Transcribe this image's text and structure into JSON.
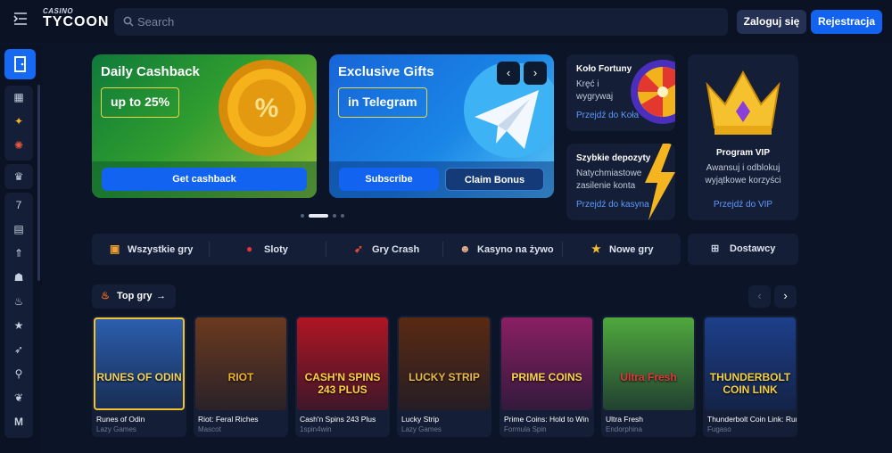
{
  "header": {
    "logo_small": "CASINO",
    "logo_big": "TYCOON",
    "search_placeholder": "Search",
    "login_label": "Zaloguj się",
    "register_label": "Rejestracja"
  },
  "banners": [
    {
      "title": "Daily Cashback",
      "badge": "up to 25%",
      "button": "Get cashback"
    },
    {
      "title": "Exclusive Gifts",
      "badge": "in Telegram",
      "button_primary": "Subscribe",
      "button_secondary": "Claim Bonus"
    }
  ],
  "wheel_card": {
    "title": "Koło Fortuny",
    "text_lines": [
      "Kręć i",
      "wygrywaj"
    ],
    "link": "Przejdź do Koła"
  },
  "deposit_card": {
    "title": "Szybkie depozyty",
    "text_lines": [
      "Natychmiastowe",
      "zasilenie konta"
    ],
    "link": "Przejdź do kasyna"
  },
  "vip_card": {
    "title": "Program VIP",
    "text_lines": [
      "Awansuj i odblokuj",
      "wyjątkowe korzyści"
    ],
    "link": "Przejdź do VIP"
  },
  "categories": [
    {
      "label": "Wszystkie gry",
      "icon": "slot-machine-icon"
    },
    {
      "label": "Sloty",
      "icon": "cherry-icon"
    },
    {
      "label": "Gry Crash",
      "icon": "rocket-icon"
    },
    {
      "label": "Kasyno na żywo",
      "icon": "dealer-icon"
    },
    {
      "label": "Nowe gry",
      "icon": "star-icon"
    }
  ],
  "providers_label": "Dostawcy",
  "top_games_label": "Top gry",
  "games": [
    {
      "name": "Runes of Odin",
      "provider": "Lazy Games",
      "thumb_text": "RUNES OF ODIN",
      "bg": "#2b5fb0",
      "accent": "#f4d35e"
    },
    {
      "name": "Riot: Feral Riches",
      "provider": "Mascot",
      "thumb_text": "RIOT",
      "bg": "#6b3a1f",
      "accent": "#f0b429"
    },
    {
      "name": "Cash'n Spins 243 Plus",
      "provider": "1spin4win",
      "thumb_text": "CASH'N SPINS 243 PLUS",
      "bg": "#b01523",
      "accent": "#ffd23f"
    },
    {
      "name": "Lucky Strip",
      "provider": "Lazy Games",
      "thumb_text": "LUCKY STRIP",
      "bg": "#5a2a12",
      "accent": "#e9b949"
    },
    {
      "name": "Prime Coins: Hold to Win",
      "provider": "Formula Spin",
      "thumb_text": "PRIME COINS",
      "bg": "#8a1f63",
      "accent": "#ffd54a"
    },
    {
      "name": "Ultra Fresh",
      "provider": "Endorphina",
      "thumb_text": "Ultra Fresh",
      "bg": "#4fa83d",
      "accent": "#e4363b"
    },
    {
      "name": "Thunderbolt Coin Link: Running Wins",
      "provider": "Fugaso",
      "thumb_text": "THUNDERBOLT COIN LINK",
      "bg": "#1d3f8a",
      "accent": "#f5d142"
    }
  ]
}
